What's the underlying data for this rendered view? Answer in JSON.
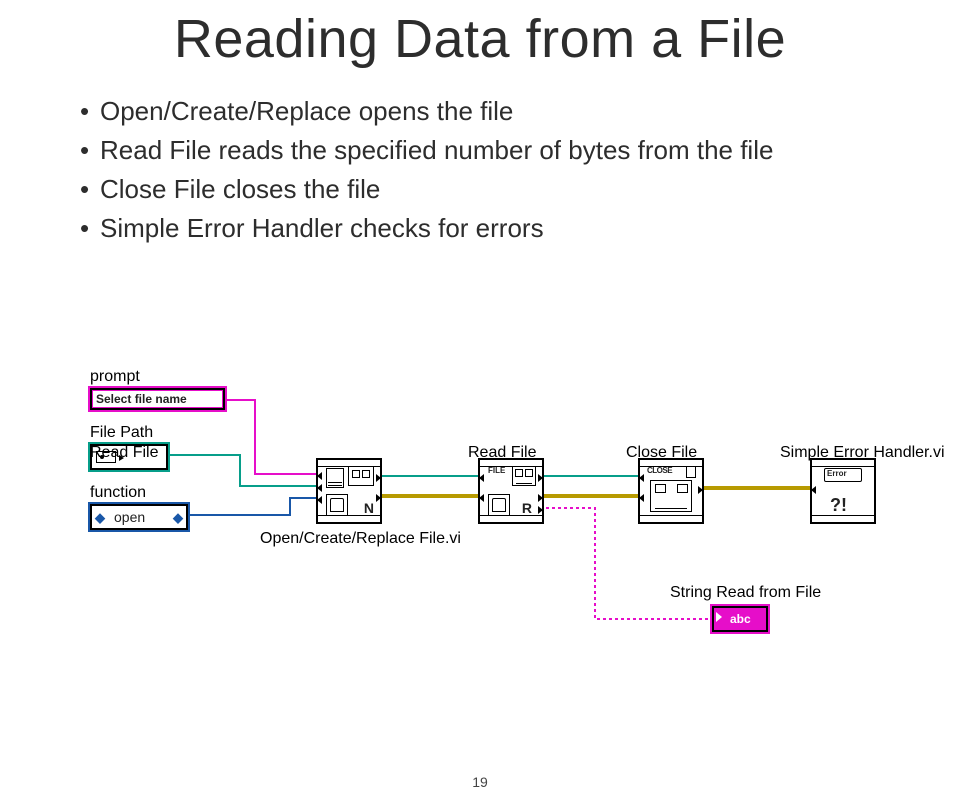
{
  "title": "Reading Data from a File",
  "bullets": [
    "Open/Create/Replace opens the file",
    "Read File reads the specified number of bytes from the file",
    "Close File closes the file",
    "Simple Error Handler checks for errors"
  ],
  "diagram": {
    "labels": {
      "prompt": "prompt",
      "prompt_value": "Select file name",
      "file_path": "File Path",
      "function": "function",
      "function_value": "open",
      "open_create_replace": "Open/Create/Replace File.vi",
      "read_file": "Read File",
      "close_file": "Close File",
      "simple_error_handler": "Simple Error Handler.vi",
      "string_read": "String Read from File",
      "string_indicator": "abc",
      "node_open_n": "N",
      "node_read_file": "FILE",
      "node_read_r": "R",
      "node_close": "CLOSE",
      "node_err": "Error",
      "node_err_mark": "?!"
    }
  },
  "page_number": "19"
}
